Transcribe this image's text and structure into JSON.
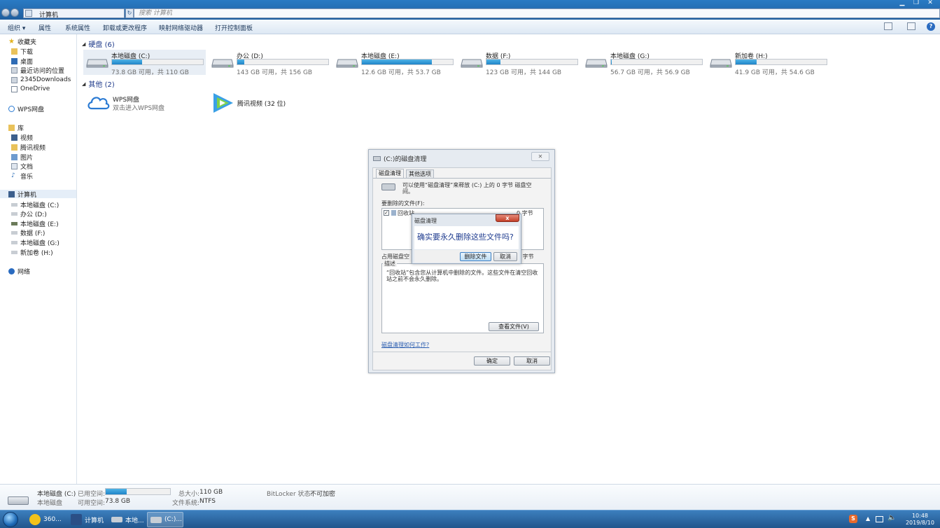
{
  "address": {
    "crumb": "计算机",
    "search_placeholder": "搜索 计算机"
  },
  "toolbar": {
    "items": [
      "组织",
      "属性",
      "系统属性",
      "卸载或更改程序",
      "映射网络驱动器",
      "打开控制面板"
    ]
  },
  "sidebar": {
    "favorites": {
      "label": "收藏夹",
      "items": [
        "下载",
        "桌面",
        "最近访问的位置",
        "2345Downloads",
        "OneDrive"
      ]
    },
    "wps": "WPS网盘",
    "library": {
      "label": "库",
      "items": [
        "视频",
        "腾讯视频",
        "图片",
        "文档",
        "音乐"
      ]
    },
    "computer": {
      "label": "计算机",
      "items": [
        "本地磁盘 (C:)",
        "办公 (D:)",
        "本地磁盘 (E:)",
        "数据 (F:)",
        "本地磁盘 (G:)",
        "新加卷 (H:)"
      ]
    },
    "network": "网络"
  },
  "groups": {
    "disks": "硬盘 (6)",
    "others": "其他 (2)"
  },
  "drives": [
    {
      "name": "本地磁盘 (C:)",
      "free": "73.8 GB 可用，共 110 GB",
      "used_fraction": 0.33
    },
    {
      "name": "办公 (D:)",
      "free": "143 GB 可用，共 156 GB",
      "used_fraction": 0.08
    },
    {
      "name": "本地磁盘 (E:)",
      "free": "12.6 GB 可用，共 53.7 GB",
      "used_fraction": 0.77
    },
    {
      "name": "数据 (F:)",
      "free": "123 GB 可用，共 144 GB",
      "used_fraction": 0.15
    },
    {
      "name": "本地磁盘 (G:)",
      "free": "56.7 GB 可用，共 56.9 GB",
      "used_fraction": 0.01
    },
    {
      "name": "新加卷 (H:)",
      "free": "41.9 GB 可用，共 54.6 GB",
      "used_fraction": 0.23
    }
  ],
  "others": [
    {
      "name": "WPS网盘",
      "sub": "双击进入WPS网盘"
    },
    {
      "name": "腾讯视频 (32 位)",
      "sub": ""
    }
  ],
  "cleanup_dialog": {
    "title": "(C:)的磁盘清理",
    "close": "✕",
    "tabs": [
      "磁盘清理",
      "其他选项"
    ],
    "intro": "可以使用“磁盘清理”来释放 (C:) 上的 0 字节 磁盘空间。",
    "files_label": "要删除的文件(F):",
    "file_item": "回收站",
    "file_size": "0 字节",
    "occupy_label": "占用磁盘空",
    "occupy_value": "0 字节",
    "desc_label": "描述",
    "desc_text": "“回收站”包含您从计算机中删除的文件。这些文件在清空回收站之前不会永久删除。",
    "view_files": "查看文件(V)",
    "howto_link": "磁盘清理如何工作?",
    "ok": "确定",
    "cancel": "取消"
  },
  "confirm_dialog": {
    "title": "磁盘清理",
    "close": "x",
    "message": "确实要永久删除这些文件吗?",
    "delete": "删除文件",
    "cancel": "取消"
  },
  "details": {
    "drive_name": "本地磁盘 (C:)",
    "drive_type": "本地磁盘",
    "used_label": "已用空间:",
    "free_label": "可用空间:",
    "free_value": "73.8 GB",
    "used_fraction": 0.33,
    "total_label": "总大小:",
    "total_value": "110 GB",
    "fs_label": "文件系统:",
    "fs_value": "NTFS",
    "bitlocker_label": "BitLocker 状态:",
    "bitlocker_value": "不可加密"
  },
  "taskbar": {
    "tasks": [
      "360...",
      "计算机",
      "本地...",
      "(C:)..."
    ],
    "time": "10:48",
    "date": "2019/8/10"
  }
}
